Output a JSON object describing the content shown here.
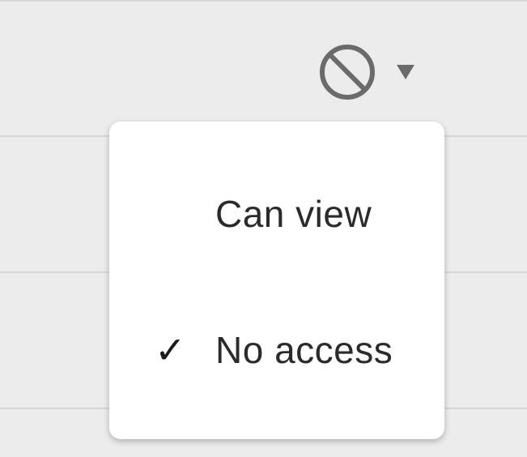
{
  "permission_control": {
    "current_icon": "ban-icon",
    "caret_icon": "caret-down-icon"
  },
  "menu": {
    "items": [
      {
        "label": "Can view",
        "selected": false
      },
      {
        "label": "No access",
        "selected": true,
        "check": "✓"
      }
    ]
  },
  "colors": {
    "background": "#ececec",
    "divider": "#d6d6d6",
    "menu_bg": "#ffffff",
    "icon": "#6b6b6b",
    "text": "#2b2b2b"
  }
}
